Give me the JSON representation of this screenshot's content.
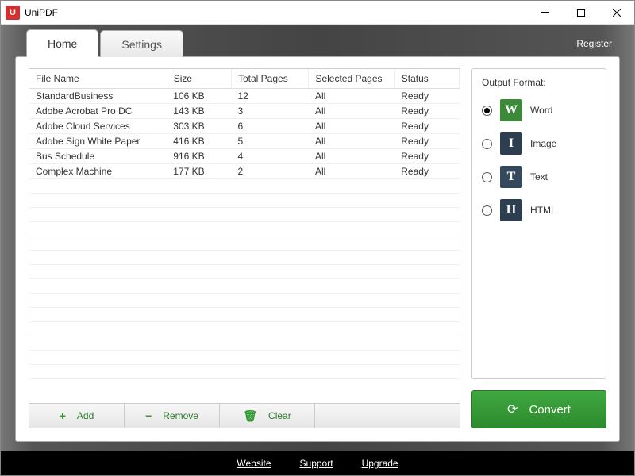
{
  "window": {
    "title": "UniPDF",
    "icon_letter": "U"
  },
  "tabs": {
    "home": "Home",
    "settings": "Settings"
  },
  "register": "Register",
  "table": {
    "headers": {
      "name": "File Name",
      "size": "Size",
      "pages": "Total Pages",
      "selected": "Selected Pages",
      "status": "Status"
    },
    "rows": [
      {
        "name": "StandardBusiness",
        "size": "106 KB",
        "pages": "12",
        "selected": "All",
        "status": "Ready"
      },
      {
        "name": "Adobe Acrobat Pro DC",
        "size": "143 KB",
        "pages": "3",
        "selected": "All",
        "status": "Ready"
      },
      {
        "name": "Adobe Cloud Services",
        "size": "303 KB",
        "pages": "6",
        "selected": "All",
        "status": "Ready"
      },
      {
        "name": "Adobe Sign White Paper",
        "size": "416 KB",
        "pages": "5",
        "selected": "All",
        "status": "Ready"
      },
      {
        "name": "Bus Schedule",
        "size": "916 KB",
        "pages": "4",
        "selected": "All",
        "status": "Ready"
      },
      {
        "name": "Complex Machine",
        "size": "177 KB",
        "pages": "2",
        "selected": "All",
        "status": "Ready"
      }
    ]
  },
  "actions": {
    "add": "Add",
    "remove": "Remove",
    "clear": "Clear"
  },
  "output": {
    "title": "Output Format:",
    "options": {
      "word": "Word",
      "image": "Image",
      "text": "Text",
      "html": "HTML"
    },
    "selected": "word"
  },
  "convert": "Convert",
  "footer": {
    "website": "Website",
    "support": "Support",
    "upgrade": "Upgrade"
  }
}
